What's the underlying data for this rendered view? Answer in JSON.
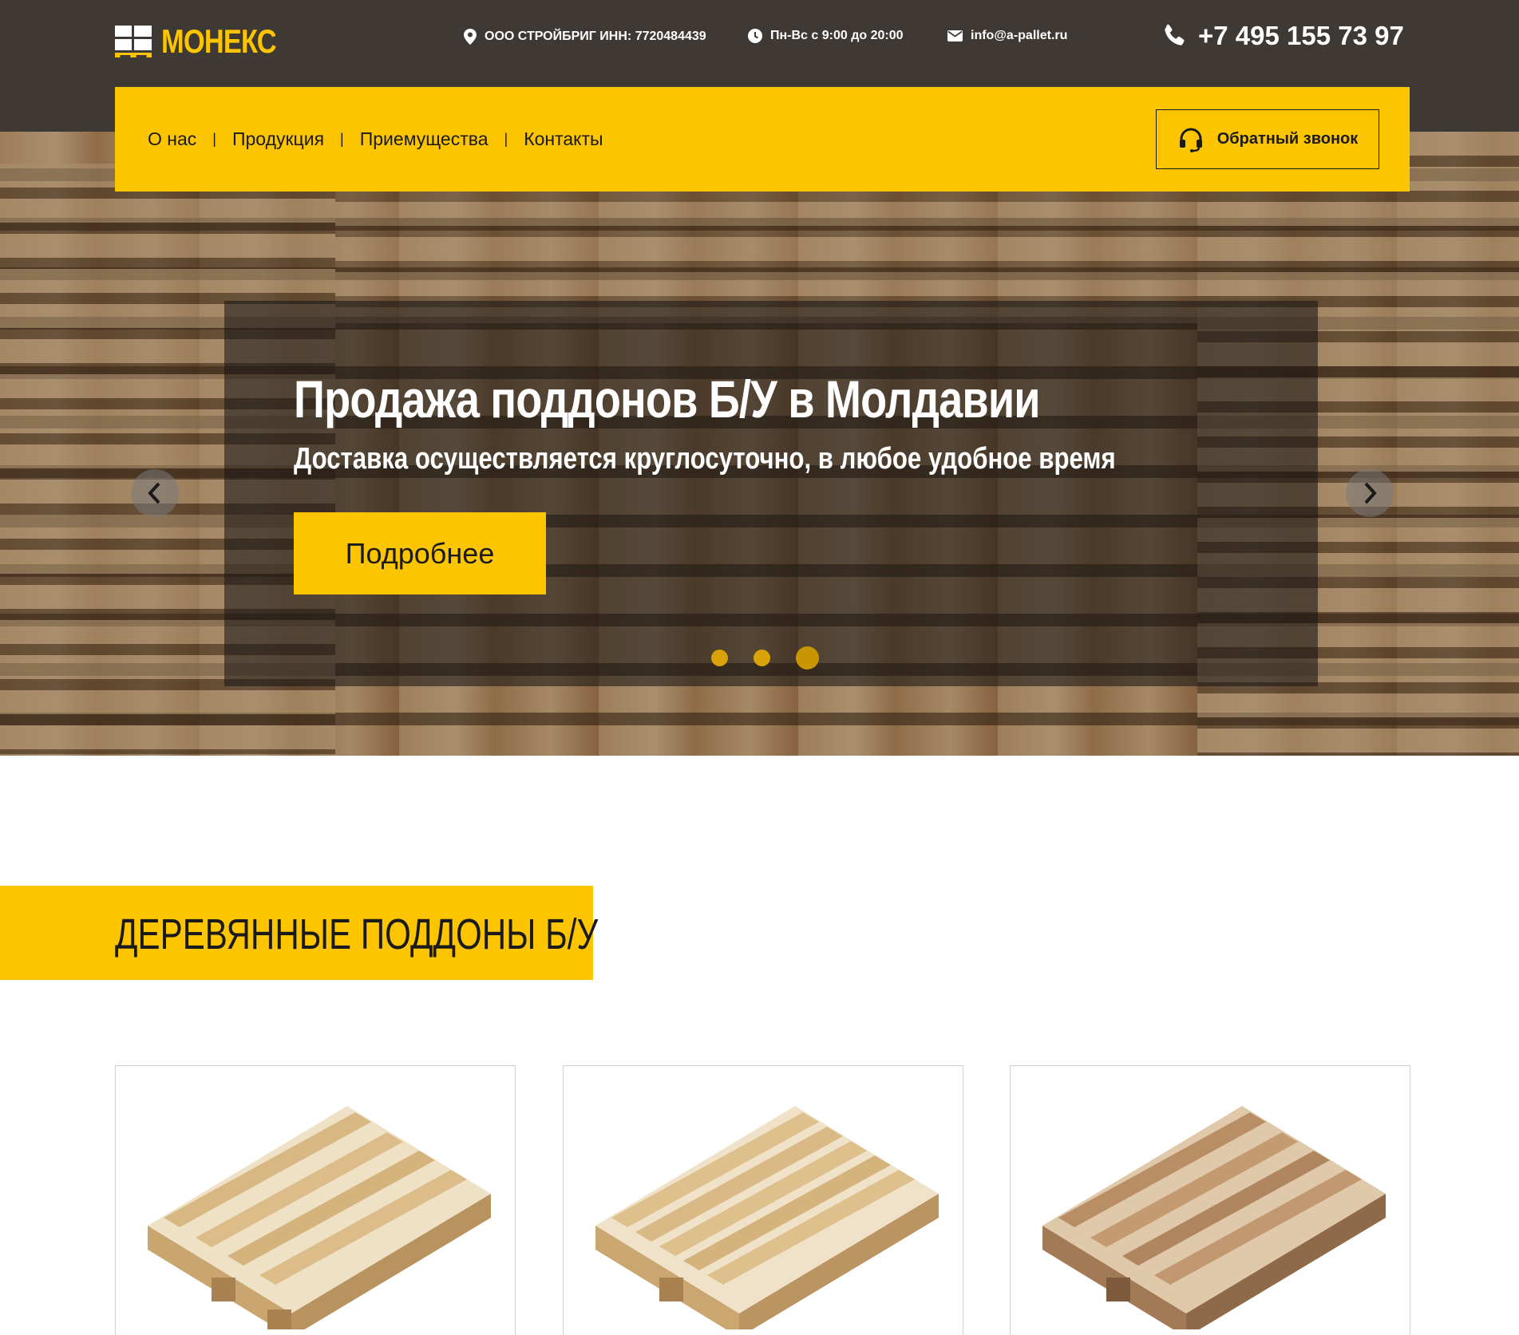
{
  "header": {
    "logo_text": "МОНЕКС",
    "address": "ООО СТРОЙБРИГ ИНН: 7720484439",
    "hours": "Пн-Вс с 9:00 до 20:00",
    "email": "info@a-pallet.ru",
    "phone": "+7 495 155 73 97"
  },
  "nav": {
    "items": [
      "О нас",
      "Продукция",
      "Приемущества",
      "Контакты"
    ],
    "separator": "|",
    "callback_label": "Обратный звонок"
  },
  "hero": {
    "title": "Продажа поддонов Б/У в Молдавии",
    "subtitle": "Доставка осуществляется круглосуточно, в любое удобное время",
    "button_label": "Подробнее",
    "slides_count": 3,
    "active_slide": 3
  },
  "section": {
    "title": "ДЕРЕВЯННЫЕ ПОДДОНЫ Б/У"
  },
  "products": [
    {
      "image": "pallet-light"
    },
    {
      "image": "pallet-light"
    },
    {
      "image": "pallet-used"
    }
  ],
  "colors": {
    "accent": "#fdc500",
    "header_bg": "#3f3935",
    "text": "#1a1a1a"
  }
}
